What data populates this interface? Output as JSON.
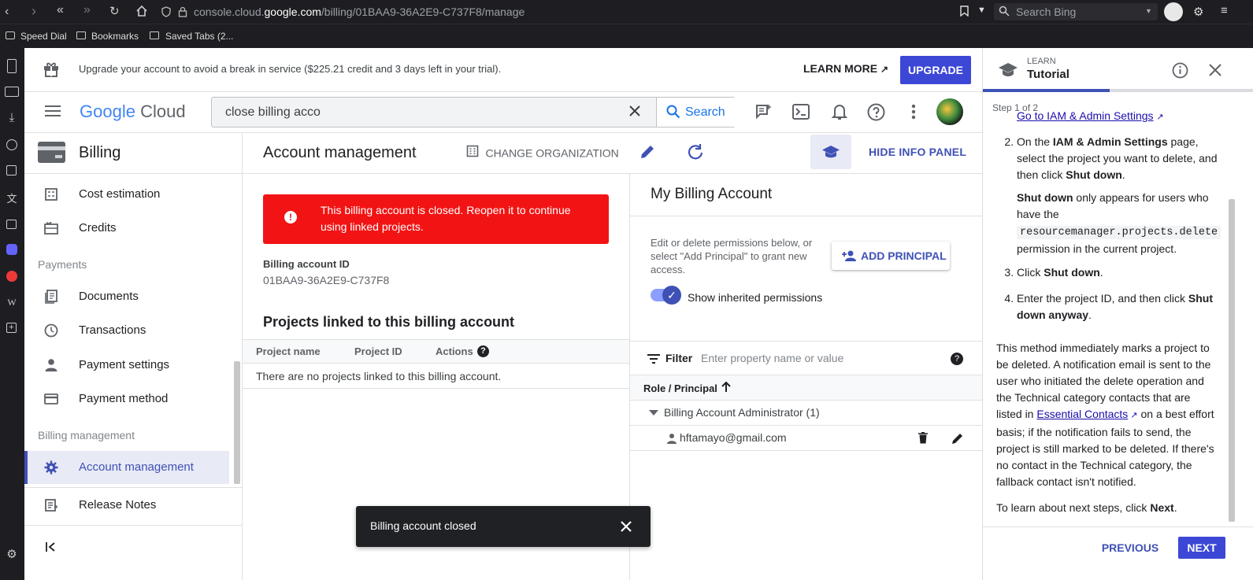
{
  "browser": {
    "url_prefix": "console.cloud.",
    "url_domain": "google.com",
    "url_path": "/billing/01BAA9-36A2E9-C737F8/manage",
    "search_placeholder": "Search Bing",
    "bookmarks": [
      "Speed Dial",
      "Bookmarks",
      "Saved Tabs (2..."
    ]
  },
  "banner": {
    "text": "Upgrade your account to avoid a break in service ($225.21 credit and 3 days left in your trial).",
    "learn_more": "LEARN MORE",
    "upgrade": "UPGRADE"
  },
  "header": {
    "logo_google": "Google",
    "logo_cloud": "Cloud",
    "search_value": "close billing acco",
    "search_button": "Search"
  },
  "nav": {
    "section_title": "Billing",
    "items_top": [
      {
        "label": "Cost estimation",
        "icon": "calculator-icon"
      },
      {
        "label": "Credits",
        "icon": "gift-card-icon"
      }
    ],
    "payments_label": "Payments",
    "payments_items": [
      {
        "label": "Documents",
        "icon": "documents-icon"
      },
      {
        "label": "Transactions",
        "icon": "clock-icon"
      },
      {
        "label": "Payment settings",
        "icon": "person-icon"
      },
      {
        "label": "Payment method",
        "icon": "credit-card-icon"
      }
    ],
    "billing_mgmt_label": "Billing management",
    "active_item": "Account management",
    "release_notes": "Release Notes"
  },
  "page": {
    "title": "Account management",
    "change_org": "CHANGE ORGANIZATION",
    "hide_info": "HIDE INFO PANEL",
    "alert_text": "This billing account is closed. Reopen it to continue using linked projects.",
    "account_id_label": "Billing account ID",
    "account_id": "01BAA9-36A2E9-C737F8",
    "projects_title": "Projects linked to this billing account",
    "columns": [
      "Project name",
      "Project ID",
      "Actions"
    ],
    "empty_text": "There are no projects linked to this billing account."
  },
  "info_panel": {
    "title": "My Billing Account",
    "description": "Edit or delete permissions below, or select \"Add Principal\" to grant new access.",
    "add_principal": "ADD PRINCIPAL",
    "show_inherited": "Show inherited permissions",
    "filter_label": "Filter",
    "filter_placeholder": "Enter property name or value",
    "col_role": "Role / Principal",
    "role_group": "Billing Account Administrator (1)",
    "principal": "hftamayo@gmail.com"
  },
  "toast": {
    "text": "Billing account closed"
  },
  "tutorial": {
    "learn": "LEARN",
    "title": "Tutorial",
    "step": "Step 1 of 2",
    "link_top": "Go to IAM & Admin Settings",
    "s2_a": "On the ",
    "s2_b": "IAM & Admin Settings",
    "s2_c": " page, select the project you want to delete, and then click ",
    "s2_d": "Shut down",
    "s2_e": ".",
    "sd_a": "Shut down",
    "sd_b": " only appears for users who have the",
    "sd_code": "resourcemanager.projects.delete",
    "sd_c": "permission in the current project.",
    "s3_a": "Click ",
    "s3_b": "Shut down",
    "s3_c": ".",
    "s4_a": "Enter the project ID, and then click ",
    "s4_b": "Shut down anyway",
    "s4_c": ".",
    "para1_a": "This method immediately marks a project to be deleted. A notification email is sent to the user who initiated the delete operation and the Technical category contacts that are listed in ",
    "para1_link": "Essential Contacts",
    "para1_b": " on a best effort basis; if the notification fails to send, the project is still marked to be deleted. If there's no contact in the Technical category, the fallback contact isn't notified.",
    "para2_a": "To learn about next steps, click ",
    "para2_b": "Next",
    "para2_c": ".",
    "previous": "PREVIOUS",
    "next": "NEXT"
  },
  "colors": {
    "accent": "#1a73e8",
    "link": "#3f51b5",
    "alert": "#f21414",
    "browser_dark": "#1e1e22"
  }
}
